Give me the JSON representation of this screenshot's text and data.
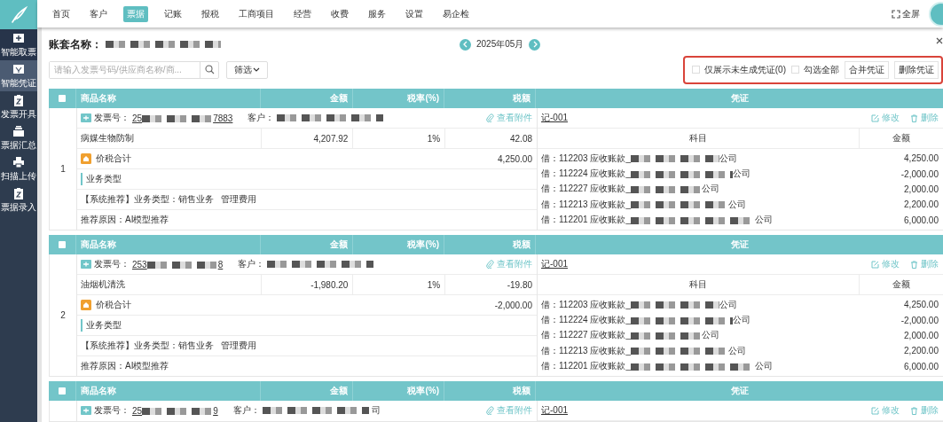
{
  "nav": {
    "items": [
      {
        "label": "首页",
        "selected": false
      },
      {
        "label": "客户",
        "selected": false
      },
      {
        "label": "票据",
        "selected": true
      },
      {
        "label": "记账",
        "selected": false
      },
      {
        "label": "报税",
        "selected": false
      },
      {
        "label": "工商项目",
        "selected": false
      },
      {
        "label": "经营",
        "selected": false
      },
      {
        "label": "收费",
        "selected": false
      },
      {
        "label": "服务",
        "selected": false
      },
      {
        "label": "设置",
        "selected": false
      },
      {
        "label": "易企检",
        "selected": false
      }
    ],
    "fullscreen": "全屏"
  },
  "sidebar": {
    "items": [
      {
        "label": "智能取票",
        "selected": false
      },
      {
        "label": "智能凭证",
        "selected": true
      },
      {
        "label": "发票开具",
        "selected": false
      },
      {
        "label": "票据汇总",
        "selected": false
      },
      {
        "label": "扫描上传",
        "selected": false
      },
      {
        "label": "票据录入",
        "selected": false
      }
    ]
  },
  "account": {
    "label": "账套名称："
  },
  "period": {
    "value": "2025年05月"
  },
  "search": {
    "placeholder": "请输入发票号码/供应商名称/商...",
    "filter": "筛选"
  },
  "toolbar": {
    "options": [
      {
        "label": "仅展示未生成凭证(0)",
        "checked": false
      },
      {
        "label": "勾选全部",
        "checked": false
      }
    ],
    "buttons": [
      "合并凭证",
      "删除凭证"
    ]
  },
  "invoices": [
    {
      "columns": [
        "商品名称",
        "金额",
        "税率(%)",
        "税额",
        "凭证"
      ],
      "index": "1",
      "checked": false,
      "invoice_label": "发票号：",
      "invoice_no_start": "25",
      "invoice_no_end": "7883",
      "customer_label": "客户：",
      "attachment": "查看附件",
      "voucher": "记-001",
      "edit": "修改",
      "delete": "删除",
      "item": {
        "name": "病媒生物防制",
        "amount": "4,207.92",
        "rate": "1%",
        "tax": "42.08"
      },
      "total_label": "价税合计",
      "total": "4,250.00",
      "business_type": "业务类型",
      "recommendation": "【系统推荐】业务类型：销售业务   管理费用",
      "reason": "推荐原因：AI模型推荐",
      "entry_columns": [
        "科目",
        "金额"
      ],
      "entries": [
        {
          "account_start": "借：112203 应收账款_",
          "account_end": "公司",
          "amount": "4,250.00"
        },
        {
          "account_start": "借：112224 应收账款_",
          "account_end": "公司",
          "amount": "-2,000.00"
        },
        {
          "account_start": "借：112227 应收账款_",
          "account_end": "公司",
          "amount": "2,000.00"
        },
        {
          "account_start": "借：112213 应收账款_",
          "account_end": "公司",
          "amount": "2,200.00"
        },
        {
          "account_start": "借：112201 应收账款_",
          "account_end": "公司",
          "amount": "6,000.00"
        }
      ]
    },
    {
      "columns": [
        "商品名称",
        "金额",
        "税率(%)",
        "税额",
        "凭证"
      ],
      "index": "2",
      "checked": false,
      "invoice_label": "发票号：",
      "invoice_no_start": "253",
      "invoice_no_end": "8",
      "customer_label": "客户：",
      "attachment": "查看附件",
      "voucher": "记-001",
      "edit": "修改",
      "delete": "删除",
      "item": {
        "name": "油烟机清洗",
        "amount": "-1,980.20",
        "rate": "1%",
        "tax": "-19.80"
      },
      "total_label": "价税合计",
      "total": "-2,000.00",
      "business_type": "业务类型",
      "recommendation": "【系统推荐】业务类型：销售业务   管理费用",
      "reason": "推荐原因：AI模型推荐",
      "entry_columns": [
        "科目",
        "金额"
      ],
      "entries": [
        {
          "account_start": "借：112203 应收账款_",
          "account_end": "公司",
          "amount": "4,250.00"
        },
        {
          "account_start": "借：112224 应收账款_",
          "account_end": "公司",
          "amount": "-2,000.00"
        },
        {
          "account_start": "借：112227 应收账款_",
          "account_end": "公司",
          "amount": "2,000.00"
        },
        {
          "account_start": "借：112213 应收账款_",
          "account_end": "公司",
          "amount": "2,200.00"
        },
        {
          "account_start": "借：112201 应收账款_",
          "account_end": "公司",
          "amount": "6,000.00"
        }
      ]
    },
    {
      "columns": [
        "商品名称",
        "金额",
        "税率(%)",
        "税额",
        "凭证"
      ],
      "checked": false,
      "invoice_label": "发票号：",
      "invoice_no_start": "25",
      "invoice_no_end": "9",
      "customer_label": "客户：",
      "customer_end": "司",
      "attachment": "查看附件",
      "voucher": "记-001",
      "edit": "修改",
      "delete": "删除"
    }
  ]
}
